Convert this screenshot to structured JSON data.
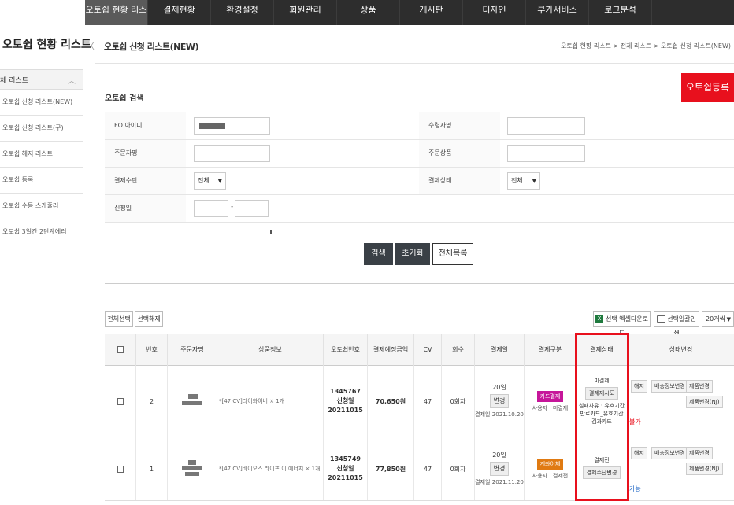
{
  "topnav": {
    "items": [
      "오토쉽 현황 리스트",
      "결제현황",
      "환경설정",
      "회원관리",
      "상품",
      "게시판",
      "디자인",
      "부가서비스",
      "로그분석"
    ]
  },
  "sidebar": {
    "title": "오토쉽 현황 리스트",
    "group_label": "체 리스트",
    "items": [
      "오토쉽 신청 리스트(NEW)",
      "오토쉽 신청 리스트(구)",
      "오토쉽 해지 리스트",
      "오토쉽 등록",
      "오토쉽 수동 스케쥴러",
      "오토쉽 3일간 2단계에러"
    ]
  },
  "header": {
    "title": "오토쉽 신청 리스트(NEW)",
    "breadcrumb": "오토쉽 현황 리스트 > 전체 리스트 > 오토쉽 신청 리스트(NEW)"
  },
  "search": {
    "section_title": "오토쉽 검색",
    "register_button": "오토쉽등록",
    "fields": {
      "fo_id": "FO 아이디",
      "receiver": "수령자명",
      "orderer": "주문자명",
      "product": "주문상품",
      "payment_method": "결제수단",
      "payment_status": "결제상태",
      "apply_date": "신청일"
    },
    "payment_method_value": "전체",
    "payment_status_value": "전체",
    "date_separator": "-",
    "buttons": {
      "search": "검색",
      "reset": "초기화",
      "all_list": "전체목록"
    }
  },
  "toolbar": {
    "select_all": "전체선택",
    "deselect": "선택해제",
    "excel_icon": "X",
    "excel_download": "선택 엑셀다운로드",
    "bulk_print": "선택일괄인쇄",
    "page_size": "20개씩"
  },
  "table": {
    "headers": [
      "번호",
      "주문자명",
      "상품정보",
      "오토쉽번호",
      "결제예정금액",
      "CV",
      "회수",
      "결제일",
      "결제구분",
      "결제상태",
      "상태변경"
    ],
    "rows": [
      {
        "no": "2",
        "product": "*[47 CV]라이화이버 × 1개",
        "autoship_no": "1345767",
        "apply_label": "신청일",
        "apply_date": "20211015",
        "amount": "70,650원",
        "cv": "47",
        "count": "0회차",
        "pay_day": "20일",
        "change_btn": "변경",
        "pay_date": "결제일:2021.10.20",
        "pay_type_badge": "카드결제",
        "pay_type_user": "사용자 : 미결제",
        "status_top": "미결제",
        "status_btn": "결제재시도",
        "status_reason": "실패사유 : 유효기간만료카드_유효기간검과카드",
        "side_note": "불가",
        "actions": [
          "해지",
          "배송정보변경",
          "제품변경",
          "제품변경(NJ)"
        ]
      },
      {
        "no": "1",
        "product": "*[47 CV]바이오스 라이프 이 에너지 × 1개",
        "autoship_no": "1345749",
        "apply_label": "신청일",
        "apply_date": "20211015",
        "amount": "77,850원",
        "cv": "47",
        "count": "0회차",
        "pay_day": "20일",
        "change_btn": "변경",
        "pay_date": "결제일:2021.11.20",
        "pay_type_badge": "계좌이체",
        "pay_type_user": "사용자 : 결제전",
        "status_top": "결제전",
        "status_btn": "결제수단변경",
        "status_reason": "",
        "side_note": "가능",
        "actions": [
          "해지",
          "배송정보변경",
          "제품변경",
          "제품변경(NJ)"
        ]
      }
    ]
  },
  "colors": {
    "nav_bg": "#2d2d2d",
    "accent_red": "#e8101d",
    "card_badge": "#c6169a",
    "transfer_badge": "#e07a12",
    "dark_button": "#3a4046"
  }
}
